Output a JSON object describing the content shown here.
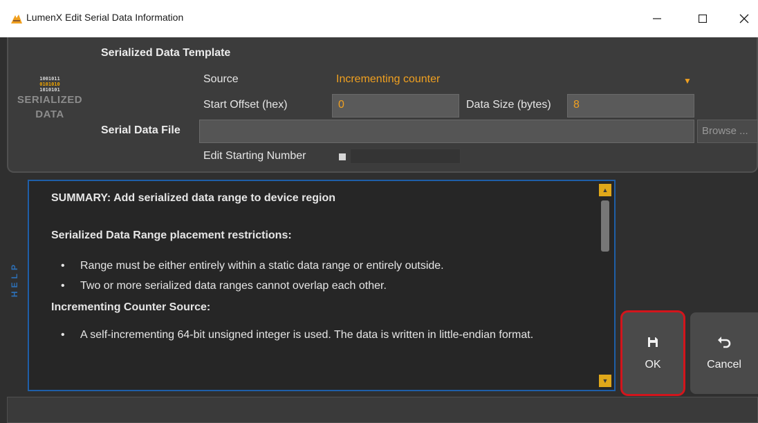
{
  "window": {
    "title": "LumenX Edit Serial Data Information",
    "controls": {
      "minimize": "—",
      "maximize": "☐",
      "close": "✕"
    }
  },
  "logo": {
    "bits": [
      "1001011",
      "0101010",
      "1010101"
    ],
    "line1": "SERIALIZED",
    "line2": "DATA"
  },
  "template": {
    "heading": "Serialized Data Template",
    "source_label": "Source",
    "source_value": "Incrementing counter",
    "start_offset_label": "Start Offset (hex)",
    "start_offset_value": "0",
    "data_size_label": "Data Size (bytes)",
    "data_size_value": "8",
    "serial_file_label": "Serial Data File",
    "serial_file_value": "",
    "browse_label": "Browse ...",
    "edit_start_label": "Edit Starting Number"
  },
  "help": {
    "tab_label": "HELP",
    "summary": "SUMMARY: Add serialized data range to device region",
    "restrictions_heading": "Serialized Data Range placement restrictions:",
    "restrictions": [
      "Range must be either entirely within a static data range or entirely outside.",
      "Two or more serialized data ranges cannot overlap each other."
    ],
    "counter_heading": "Incrementing Counter Source:",
    "counter_items": [
      "A self-incrementing 64-bit unsigned integer is used. The data is written in little-endian format."
    ]
  },
  "buttons": {
    "ok_label": "OK",
    "cancel_label": "Cancel"
  },
  "colors": {
    "accent": "#f0a020",
    "help_border": "#1f5fa8",
    "ok_highlight": "#d3151c"
  }
}
